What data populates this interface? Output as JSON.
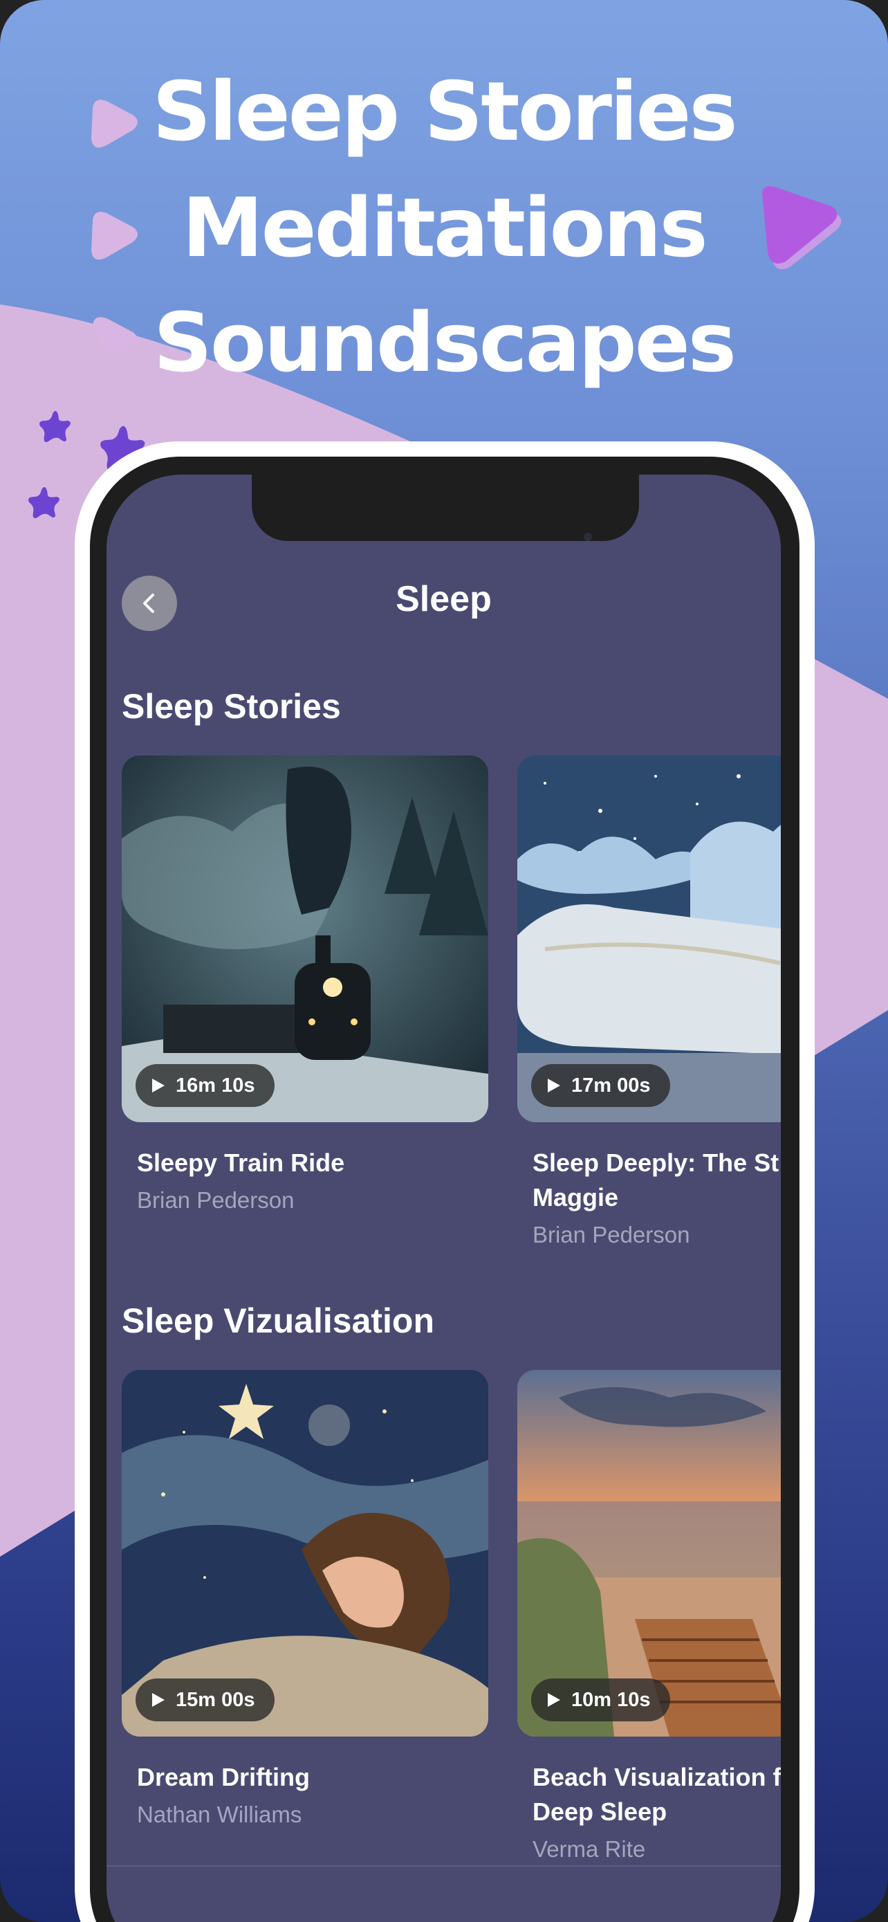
{
  "hero": {
    "line1": "Sleep Stories",
    "line2": "Meditations",
    "line3": "Soundscapes"
  },
  "nav": {
    "title": "Sleep",
    "back_icon": "chevron-left-icon"
  },
  "sections": [
    {
      "title": "Sleep Stories",
      "cards": [
        {
          "duration": "16m 10s",
          "title": "Sleepy Train Ride",
          "author": "Brian Pederson",
          "image": "night-train-image"
        },
        {
          "duration": "17m 00s",
          "title": "Sleep Deeply: The St",
          "title_line2": "Maggie",
          "author": "Brian Pederson",
          "image": "cloud-pillow-image"
        }
      ]
    },
    {
      "title": "Sleep Vizualisation",
      "cards": [
        {
          "duration": "15m 00s",
          "title": "Dream Drifting",
          "author": "Nathan Williams",
          "image": "dreaming-woman-image"
        },
        {
          "duration": "10m 10s",
          "title": "Beach Visualization fo",
          "title_line2": "Deep Sleep",
          "author": "Verma Rite",
          "image": "sunset-beach-image"
        }
      ]
    }
  ],
  "colors": {
    "screen_bg": "#4a4a71",
    "accent_purple": "#b35be0",
    "star_purple": "#6c44d1",
    "bubble_pink": "#cdb3e1"
  }
}
